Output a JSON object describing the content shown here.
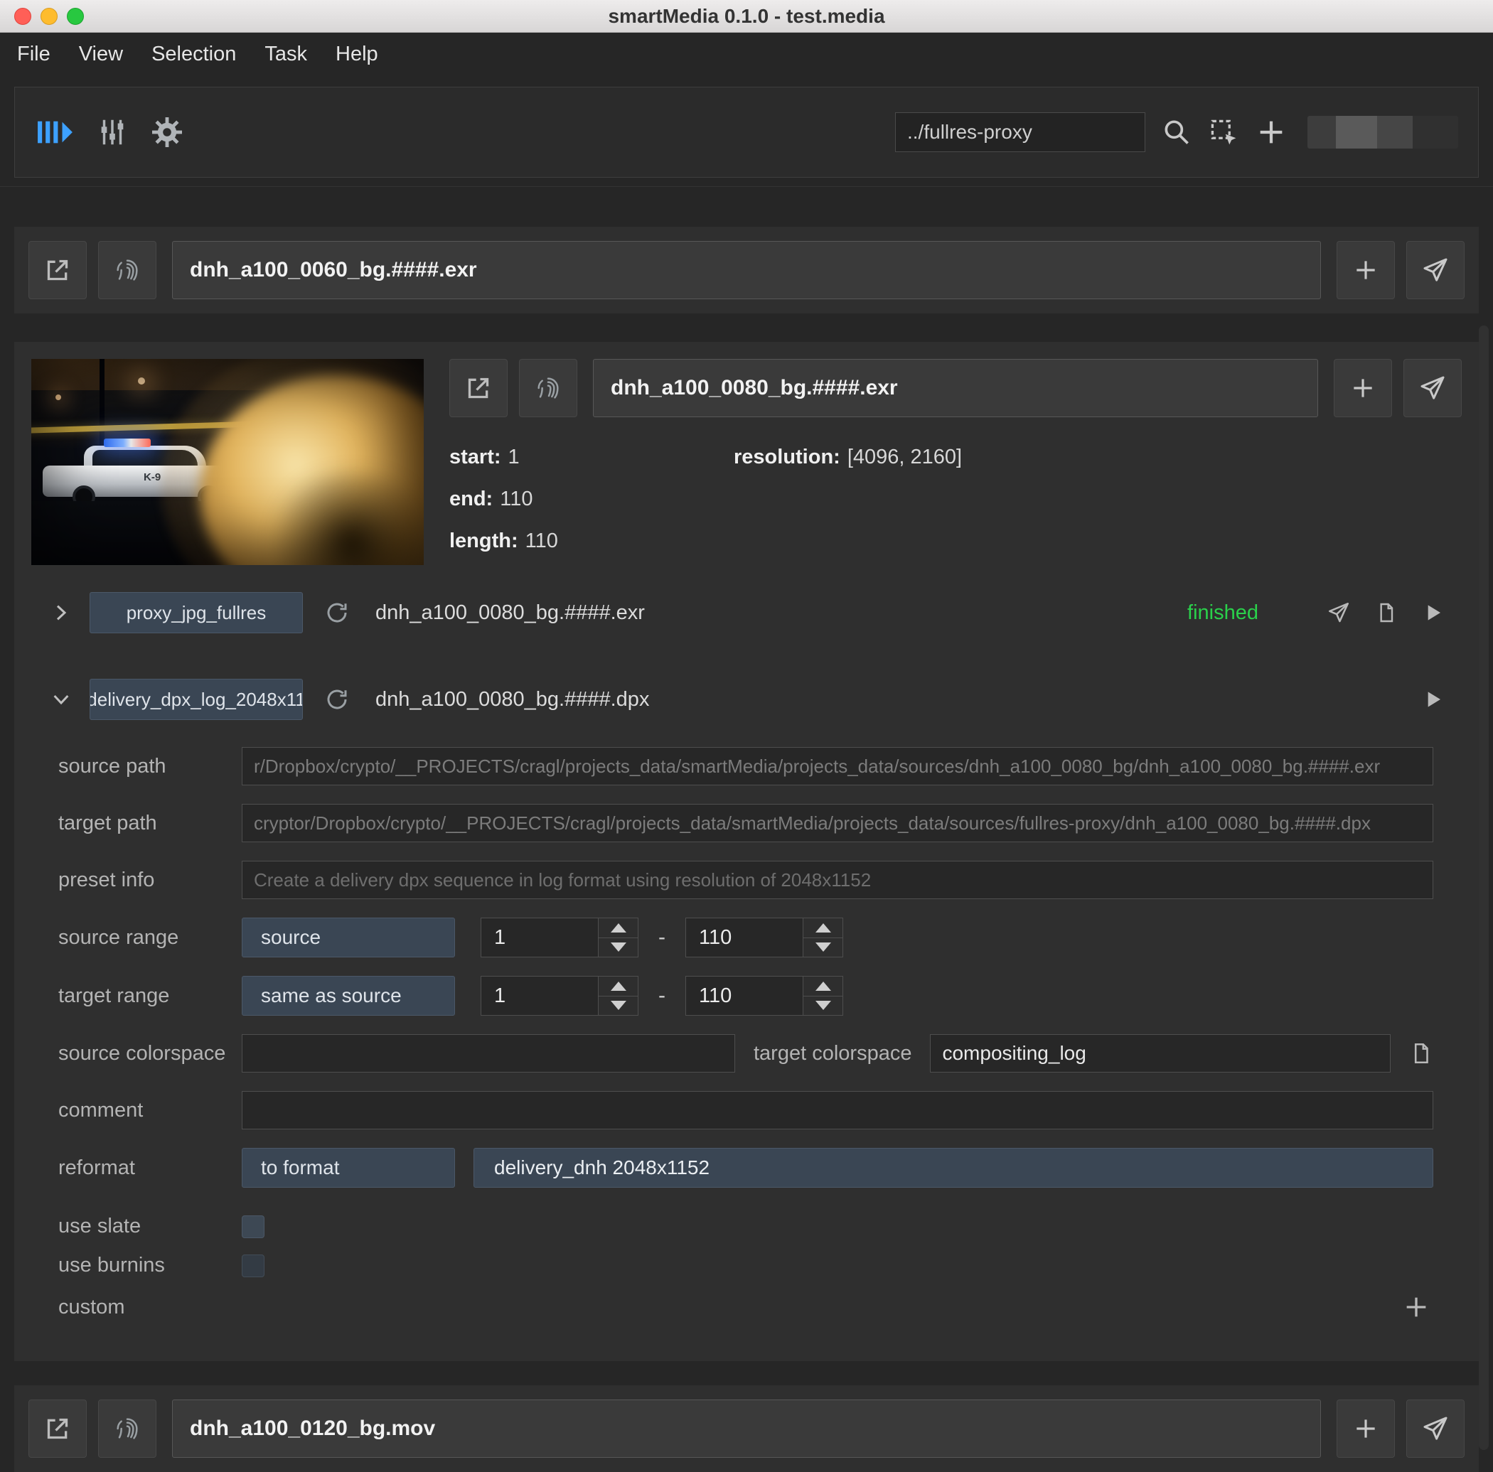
{
  "window": {
    "title": "smartMedia 0.1.0 - test.media"
  },
  "menu": {
    "items": [
      "File",
      "View",
      "Selection",
      "Task",
      "Help"
    ]
  },
  "toolbar": {
    "path_value": "../fullres-proxy"
  },
  "media_top": {
    "filename": "dnh_a100_0060_bg.####.exr"
  },
  "media_bottom": {
    "filename": "dnh_a100_0120_bg.mov"
  },
  "clip": {
    "filename": "dnh_a100_0080_bg.####.exr",
    "thumbnail": {
      "car_marking": "K-9"
    },
    "meta": {
      "start_label": "start:",
      "start_value": "1",
      "end_label": "end:",
      "end_value": "110",
      "length_label": "length:",
      "length_value": "110",
      "resolution_label": "resolution:",
      "resolution_value": "[4096, 2160]"
    },
    "tasks": [
      {
        "preset": "proxy_jpg_fullres",
        "output": "dnh_a100_0080_bg.####.exr",
        "status": "finished"
      },
      {
        "preset": "delivery_dpx_log_2048x11",
        "output": "dnh_a100_0080_bg.####.dpx"
      }
    ],
    "form": {
      "source_path_label": "source path",
      "source_path_value": "r/Dropbox/crypto/__PROJECTS/cragl/projects_data/smartMedia/projects_data/sources/dnh_a100_0080_bg/dnh_a100_0080_bg.####.exr",
      "target_path_label": "target path",
      "target_path_value": "cryptor/Dropbox/crypto/__PROJECTS/cragl/projects_data/smartMedia/projects_data/sources/fullres-proxy/dnh_a100_0080_bg.####.dpx",
      "preset_info_label": "preset info",
      "preset_info_value": "Create a delivery dpx sequence in log format using resolution of 2048x1152",
      "source_range_label": "source range",
      "source_range_mode": "source",
      "source_range_start": "1",
      "source_range_end": "110",
      "target_range_label": "target range",
      "target_range_mode": "same as source",
      "target_range_start": "1",
      "target_range_end": "110",
      "range_dash": "-",
      "source_colorspace_label": "source colorspace",
      "source_colorspace_value": "",
      "target_colorspace_label": "target colorspace",
      "target_colorspace_value": "compositing_log",
      "comment_label": "comment",
      "comment_value": "",
      "reformat_label": "reformat",
      "reformat_mode": "to format",
      "reformat_value": "delivery_dnh 2048x1152",
      "use_slate_label": "use slate",
      "use_burnins_label": "use burnins",
      "custom_label": "custom"
    }
  },
  "colors": {
    "accent_blue": "#3da1ff",
    "status_finished_green": "#2ad14b",
    "slate_button": "#3a4654"
  }
}
